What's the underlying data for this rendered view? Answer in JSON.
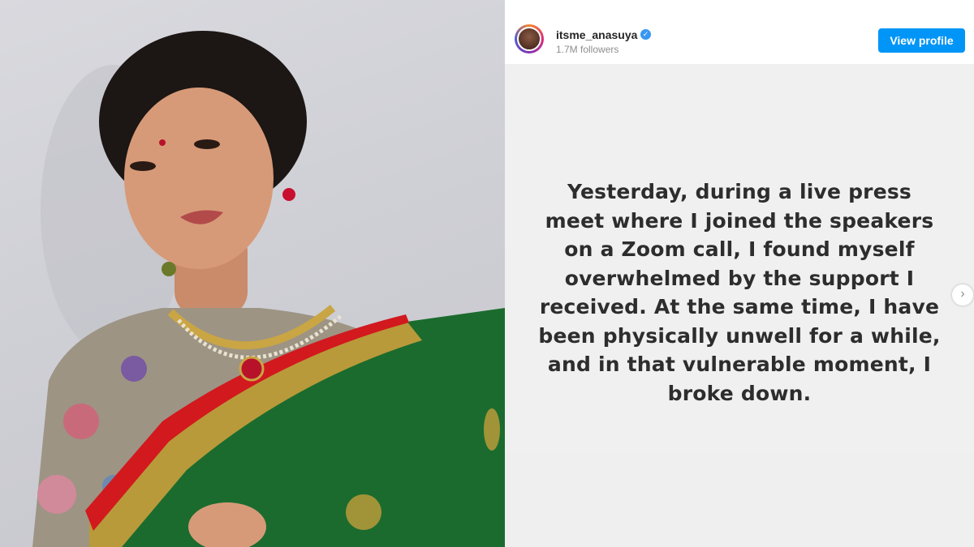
{
  "profile": {
    "username": "itsme_anasuya",
    "verified_mark": "✓",
    "followers": "1.7M followers",
    "view_profile_label": "View profile",
    "avatar_icon": "avatar-icon"
  },
  "post": {
    "text": "Yesterday, during a live press meet where I joined the speakers on a Zoom call, I found myself overwhelmed by the support I received. At the same time, I have been physically unwell for a while, and in that vulnerable moment, I broke down.",
    "next_arrow": "›"
  },
  "colors": {
    "accent_blue": "#0095f6",
    "verified_blue": "#3897f0",
    "saree_green": "#1b6b2e",
    "saree_gold": "#b89a3a",
    "saree_red": "#d2191e"
  }
}
